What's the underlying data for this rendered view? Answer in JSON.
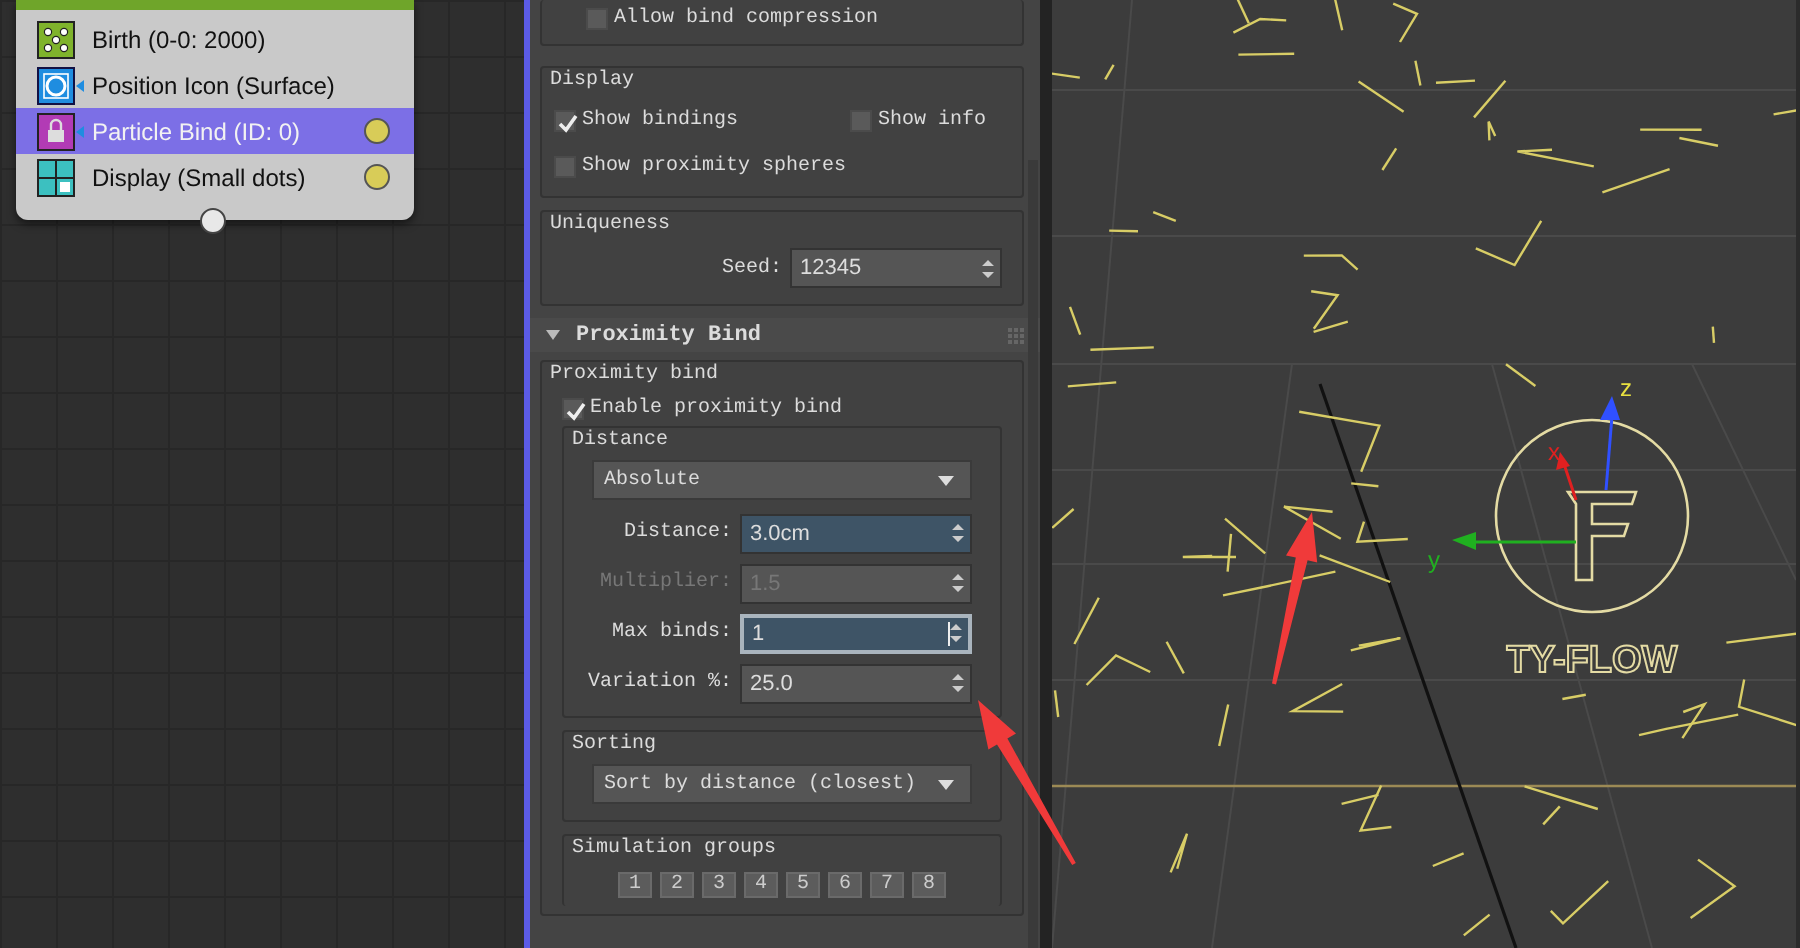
{
  "node": {
    "operators": [
      {
        "kind": "birth",
        "label": "Birth (0-0: 2000)",
        "selected": false,
        "output": false
      },
      {
        "kind": "position",
        "label": "Position Icon (Surface)",
        "selected": false,
        "output": false
      },
      {
        "kind": "bind",
        "label": "Particle Bind (ID: 0)",
        "selected": true,
        "output": true
      },
      {
        "kind": "display",
        "label": "Display (Small dots)",
        "selected": false,
        "output": true
      }
    ]
  },
  "panel": {
    "bind_options": {
      "checkbox": {
        "label": "Allow bind compression",
        "checked": false
      }
    },
    "display": {
      "title": "Display",
      "checkboxes": [
        {
          "label": "Show bindings",
          "checked": true
        },
        {
          "label": "Show info",
          "checked": false
        },
        {
          "label": "Show proximity spheres",
          "checked": false
        }
      ]
    },
    "uniqueness": {
      "title": "Uniqueness",
      "seed": {
        "label": "Seed:",
        "value": "12345"
      }
    },
    "proximity_bind": {
      "title": "Proximity Bind",
      "group_title": "Proximity bind",
      "enable": {
        "label": "Enable proximity bind",
        "checked": true
      },
      "distance": {
        "title": "Distance",
        "mode": "Absolute",
        "fields": [
          {
            "label": "Distance:",
            "value": "3.0cm",
            "highlighted": true,
            "focused": false,
            "disabled": false
          },
          {
            "label": "Multiplier:",
            "value": "1.5",
            "highlighted": false,
            "focused": false,
            "disabled": true
          },
          {
            "label": "Max binds:",
            "value": "1",
            "highlighted": false,
            "focused": true,
            "disabled": false
          },
          {
            "label": "Variation %:",
            "value": "25.0",
            "highlighted": false,
            "focused": false,
            "disabled": false
          }
        ]
      },
      "sorting": {
        "title": "Sorting",
        "mode": "Sort by distance (closest)"
      },
      "simulation_groups": {
        "title": "Simulation groups",
        "buttons": [
          "1",
          "2",
          "3",
          "4",
          "5",
          "6",
          "7",
          "8"
        ]
      }
    }
  },
  "viewport": {
    "gizmo": {
      "z_label": "z",
      "x_label": "x",
      "y_label": "y"
    },
    "logo": "TY-FLOW"
  }
}
